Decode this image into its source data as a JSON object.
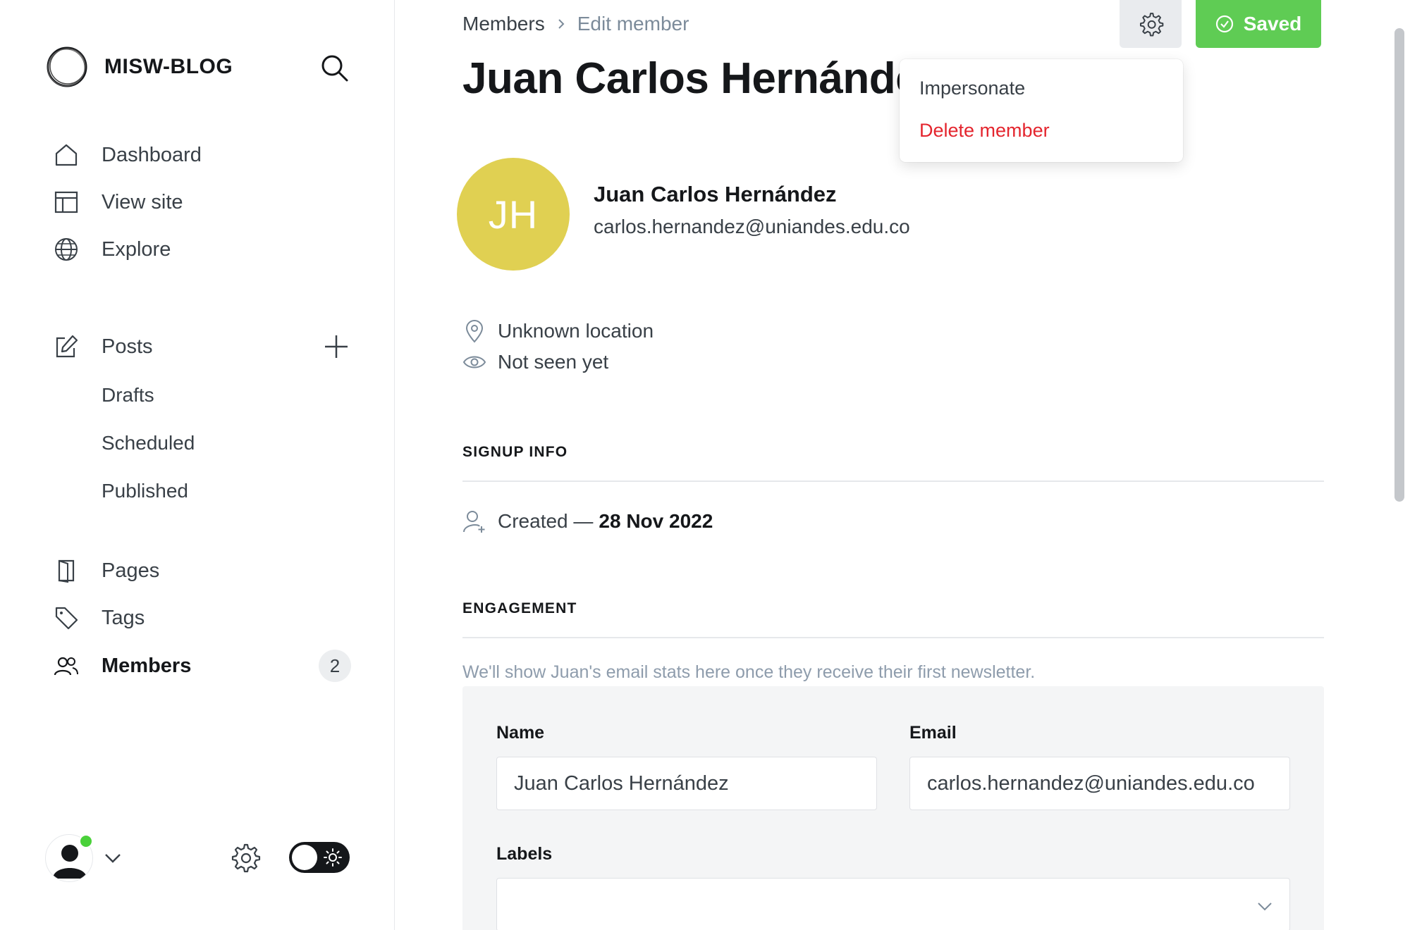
{
  "brand": {
    "name": "MISW-BLOG"
  },
  "sidebar": {
    "nav": [
      {
        "label": "Dashboard",
        "icon": "home-icon"
      },
      {
        "label": "View site",
        "icon": "layout-icon"
      },
      {
        "label": "Explore",
        "icon": "globe-icon"
      }
    ],
    "posts": {
      "label": "Posts",
      "icon": "pencil-square-icon"
    },
    "post_sub": [
      "Drafts",
      "Scheduled",
      "Published"
    ],
    "pages": {
      "label": "Pages",
      "icon": "pages-icon"
    },
    "tags": {
      "label": "Tags",
      "icon": "tag-icon"
    },
    "members": {
      "label": "Members",
      "icon": "users-icon",
      "count": "2"
    }
  },
  "breadcrumb": {
    "parent": "Members",
    "current": "Edit member"
  },
  "page": {
    "title": "Juan Carlos Hernández"
  },
  "actions": {
    "saved_label": "Saved"
  },
  "menu": {
    "impersonate": "Impersonate",
    "delete": "Delete member"
  },
  "member": {
    "initials": "JH",
    "name": "Juan Carlos Hernández",
    "email": "carlos.hernandez@uniandes.edu.co",
    "location": "Unknown location",
    "last_seen": "Not seen yet",
    "avatar_color": "#e0d052"
  },
  "signup": {
    "heading": "SIGNUP INFO",
    "created_prefix": "Created —",
    "created_date": "28 Nov 2022"
  },
  "engagement": {
    "heading": "ENGAGEMENT",
    "note": "We'll show Juan's email stats here once they receive their first newsletter."
  },
  "form": {
    "name_label": "Name",
    "name_value": "Juan Carlos Hernández",
    "email_label": "Email",
    "email_value": "carlos.hernandez@uniandes.edu.co",
    "labels_label": "Labels"
  },
  "colors": {
    "accent_green": "#5fcc54",
    "danger_red": "#e4252e",
    "online": "#4ad13a"
  }
}
